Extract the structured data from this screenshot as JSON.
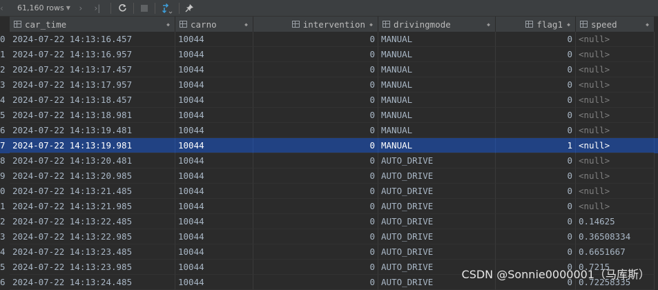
{
  "toolbar": {
    "row_count": "61,160 rows",
    "icons": [
      "prev-page-icon",
      "next-page-icon",
      "last-page-icon",
      "refresh-icon",
      "stop-icon",
      "transpose-icon",
      "pin-icon"
    ]
  },
  "columns": [
    {
      "label": "car_time"
    },
    {
      "label": "carno"
    },
    {
      "label": "intervention"
    },
    {
      "label": "drivingmode"
    },
    {
      "label": "flag1"
    },
    {
      "label": "speed"
    }
  ],
  "rows": [
    {
      "n": "0",
      "car_time": "2024-07-22 14:13:16.457",
      "carno": "10044",
      "intervention": "0",
      "drivingmode": "MANUAL",
      "flag1": "0",
      "speed": "<null>"
    },
    {
      "n": "1",
      "car_time": "2024-07-22 14:13:16.957",
      "carno": "10044",
      "intervention": "0",
      "drivingmode": "MANUAL",
      "flag1": "0",
      "speed": "<null>"
    },
    {
      "n": "2",
      "car_time": "2024-07-22 14:13:17.457",
      "carno": "10044",
      "intervention": "0",
      "drivingmode": "MANUAL",
      "flag1": "0",
      "speed": "<null>"
    },
    {
      "n": "3",
      "car_time": "2024-07-22 14:13:17.957",
      "carno": "10044",
      "intervention": "0",
      "drivingmode": "MANUAL",
      "flag1": "0",
      "speed": "<null>"
    },
    {
      "n": "4",
      "car_time": "2024-07-22 14:13:18.457",
      "carno": "10044",
      "intervention": "0",
      "drivingmode": "MANUAL",
      "flag1": "0",
      "speed": "<null>"
    },
    {
      "n": "5",
      "car_time": "2024-07-22 14:13:18.981",
      "carno": "10044",
      "intervention": "0",
      "drivingmode": "MANUAL",
      "flag1": "0",
      "speed": "<null>"
    },
    {
      "n": "6",
      "car_time": "2024-07-22 14:13:19.481",
      "carno": "10044",
      "intervention": "0",
      "drivingmode": "MANUAL",
      "flag1": "0",
      "speed": "<null>"
    },
    {
      "n": "7",
      "car_time": "2024-07-22 14:13:19.981",
      "carno": "10044",
      "intervention": "0",
      "drivingmode": "MANUAL",
      "flag1": "1",
      "speed": "<null>",
      "selected": true
    },
    {
      "n": "8",
      "car_time": "2024-07-22 14:13:20.481",
      "carno": "10044",
      "intervention": "0",
      "drivingmode": "AUTO_DRIVE",
      "flag1": "0",
      "speed": "<null>"
    },
    {
      "n": "9",
      "car_time": "2024-07-22 14:13:20.985",
      "carno": "10044",
      "intervention": "0",
      "drivingmode": "AUTO_DRIVE",
      "flag1": "0",
      "speed": "<null>"
    },
    {
      "n": "0",
      "car_time": "2024-07-22 14:13:21.485",
      "carno": "10044",
      "intervention": "0",
      "drivingmode": "AUTO_DRIVE",
      "flag1": "0",
      "speed": "<null>"
    },
    {
      "n": "1",
      "car_time": "2024-07-22 14:13:21.985",
      "carno": "10044",
      "intervention": "0",
      "drivingmode": "AUTO_DRIVE",
      "flag1": "0",
      "speed": "<null>"
    },
    {
      "n": "2",
      "car_time": "2024-07-22 14:13:22.485",
      "carno": "10044",
      "intervention": "0",
      "drivingmode": "AUTO_DRIVE",
      "flag1": "0",
      "speed": "0.14625"
    },
    {
      "n": "3",
      "car_time": "2024-07-22 14:13:22.985",
      "carno": "10044",
      "intervention": "0",
      "drivingmode": "AUTO_DRIVE",
      "flag1": "0",
      "speed": "0.36508334"
    },
    {
      "n": "4",
      "car_time": "2024-07-22 14:13:23.485",
      "carno": "10044",
      "intervention": "0",
      "drivingmode": "AUTO_DRIVE",
      "flag1": "0",
      "speed": "0.6651667"
    },
    {
      "n": "5",
      "car_time": "2024-07-22 14:13:23.985",
      "carno": "10044",
      "intervention": "0",
      "drivingmode": "AUTO_DRIVE",
      "flag1": "0",
      "speed": "0.7215"
    },
    {
      "n": "6",
      "car_time": "2024-07-22 14:13:24.485",
      "carno": "10044",
      "intervention": "0",
      "drivingmode": "AUTO_DRIVE",
      "flag1": "0",
      "speed": "0.72258335"
    }
  ],
  "watermark": "CSDN @Sonnie0000001（马库斯）",
  "colors": {
    "selection": "#214283",
    "background": "#2b2b2b",
    "header": "#3c3f41"
  }
}
